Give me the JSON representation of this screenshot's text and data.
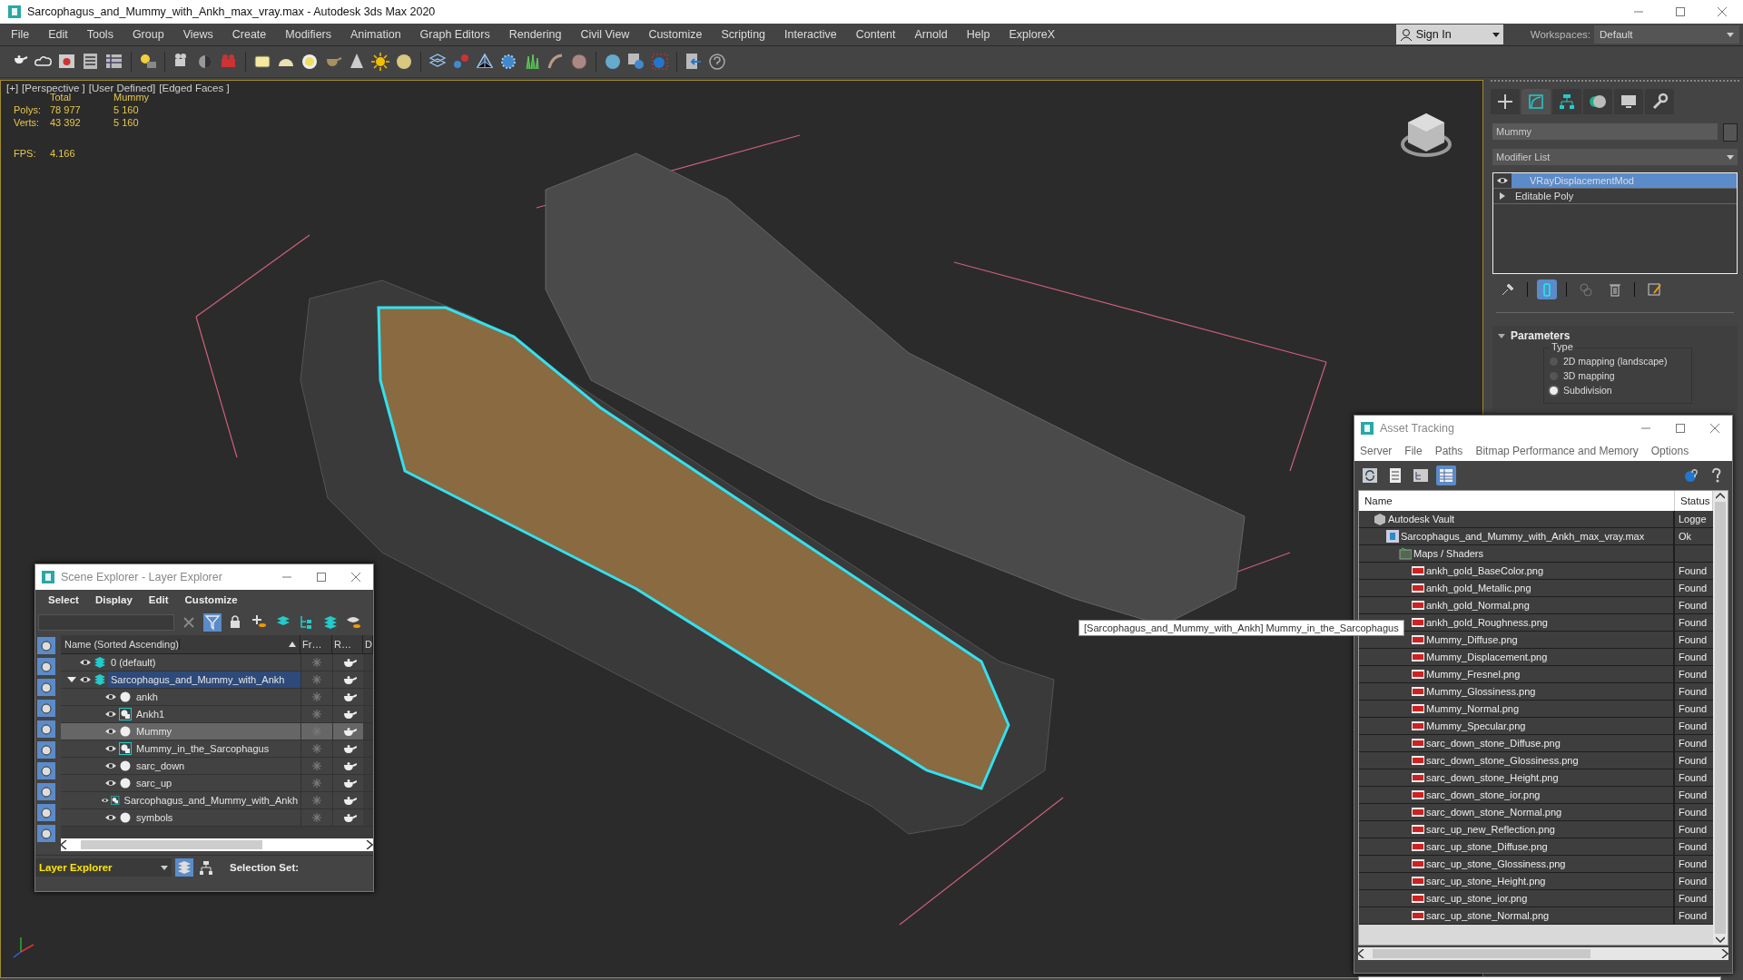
{
  "window": {
    "title": "Sarcophagus_and_Mummy_with_Ankh_max_vray.max - Autodesk 3ds Max 2020"
  },
  "menu": [
    "File",
    "Edit",
    "Tools",
    "Group",
    "Views",
    "Create",
    "Modifiers",
    "Animation",
    "Graph Editors",
    "Rendering",
    "Civil View",
    "Customize",
    "Scripting",
    "Interactive",
    "Content",
    "Arnold",
    "Help",
    "ExploreX"
  ],
  "sign_in": {
    "label": "Sign In"
  },
  "workspaces": {
    "label": "Workspaces:",
    "value": "Default"
  },
  "viewport": {
    "labels": [
      "[+]",
      "[Perspective ]",
      "[User Defined]",
      "[Edged Faces ]"
    ],
    "stats": {
      "headers": [
        "Total",
        "Mummy"
      ],
      "rows": [
        {
          "label": "Polys:",
          "values": [
            "78 977",
            "5 160"
          ]
        },
        {
          "label": "Verts:",
          "values": [
            "43 392",
            "5 160"
          ]
        }
      ],
      "fps": {
        "label": "FPS:",
        "value": "4.166"
      }
    },
    "tooltip": "[Sarcophagus_and_Mummy_with_Ankh] Mummy_in_the_Sarcophagus"
  },
  "command_panel": {
    "tabs": [
      {
        "selected": false
      },
      {
        "selected": true
      },
      {
        "selected": false
      },
      {
        "selected": false
      },
      {
        "selected": false
      },
      {
        "selected": false
      }
    ],
    "object_name": "Mummy",
    "modifier_list": "Modifier List",
    "stack": [
      {
        "label": "VRayDisplacementMod",
        "kind": "modifier",
        "selected": true
      },
      {
        "label": "Editable Poly",
        "kind": "base",
        "selected": false
      }
    ],
    "show_end_result": true,
    "parameters": {
      "title": "Parameters",
      "group": "Type",
      "options": [
        {
          "label": "2D mapping (landscape)",
          "selected": false
        },
        {
          "label": "3D mapping",
          "selected": false
        },
        {
          "label": "Subdivision",
          "selected": true
        }
      ]
    }
  },
  "scene_explorer": {
    "title": "Scene Explorer - Layer Explorer",
    "menu": [
      "Select",
      "Display",
      "Edit",
      "Customize"
    ],
    "filter_on": true,
    "display_filters": [
      {
        "on": true
      },
      {
        "on": true
      },
      {
        "on": true
      },
      {
        "on": true
      },
      {
        "on": true
      },
      {
        "on": true
      },
      {
        "on": true
      },
      {
        "on": true
      },
      {
        "on": true
      },
      {
        "on": true
      }
    ],
    "columns": [
      "Name (Sorted Ascending)",
      "Fr…",
      "R…",
      "D"
    ],
    "tree": [
      {
        "name": "0 (default)",
        "kind": "layer",
        "selected": false
      },
      {
        "name": "Sarcophagus_and_Mummy_with_Ankh",
        "kind": "layer",
        "selected": true,
        "expanded": true,
        "children": [
          {
            "name": "ankh",
            "kind": "object",
            "selected": false
          },
          {
            "name": "Ankh1",
            "kind": "group",
            "selected": false
          },
          {
            "name": "Mummy",
            "kind": "object",
            "selected": true
          },
          {
            "name": "Mummy_in_the_Sarcophagus",
            "kind": "group",
            "selected": false
          },
          {
            "name": "sarc_down",
            "kind": "object",
            "selected": false
          },
          {
            "name": "sarc_up",
            "kind": "object",
            "selected": false
          },
          {
            "name": "Sarcophagus_and_Mummy_with_Ankh",
            "kind": "group",
            "selected": false
          },
          {
            "name": "symbols",
            "kind": "object",
            "selected": false
          }
        ]
      }
    ],
    "footer": {
      "explorer": "Layer Explorer",
      "selection_set": "Selection Set:"
    }
  },
  "asset_tracking": {
    "title": "Asset Tracking",
    "menu": [
      "Server",
      "File",
      "Paths",
      "Bitmap Performance and Memory",
      "Options"
    ],
    "view_buttons": [
      {
        "selected": false
      },
      {
        "selected": false
      },
      {
        "selected": false
      },
      {
        "selected": true
      }
    ],
    "columns": [
      "Name",
      "Status"
    ],
    "tree": [
      {
        "name": "Autodesk Vault",
        "kind": "vault",
        "status": "Logge",
        "children": [
          {
            "name": "Sarcophagus_and_Mummy_with_Ankh_max_vray.max",
            "kind": "scene",
            "status": "Ok",
            "children": [
              {
                "name": "Maps / Shaders",
                "kind": "folder",
                "children": [
                  {
                    "name": "ankh_gold_BaseColor.png",
                    "kind": "png",
                    "status": "Found"
                  },
                  {
                    "name": "ankh_gold_Metallic.png",
                    "kind": "png",
                    "status": "Found"
                  },
                  {
                    "name": "ankh_gold_Normal.png",
                    "kind": "png",
                    "status": "Found"
                  },
                  {
                    "name": "ankh_gold_Roughness.png",
                    "kind": "png",
                    "status": "Found"
                  },
                  {
                    "name": "Mummy_Diffuse.png",
                    "kind": "png",
                    "status": "Found"
                  },
                  {
                    "name": "Mummy_Displacement.png",
                    "kind": "png",
                    "status": "Found"
                  },
                  {
                    "name": "Mummy_Fresnel.png",
                    "kind": "png",
                    "status": "Found"
                  },
                  {
                    "name": "Mummy_Glossiness.png",
                    "kind": "png",
                    "status": "Found"
                  },
                  {
                    "name": "Mummy_Normal.png",
                    "kind": "png",
                    "status": "Found"
                  },
                  {
                    "name": "Mummy_Specular.png",
                    "kind": "png",
                    "status": "Found"
                  },
                  {
                    "name": "sarc_down_stone_Diffuse.png",
                    "kind": "png",
                    "status": "Found"
                  },
                  {
                    "name": "sarc_down_stone_Glossiness.png",
                    "kind": "png",
                    "status": "Found"
                  },
                  {
                    "name": "sarc_down_stone_Height.png",
                    "kind": "png",
                    "status": "Found"
                  },
                  {
                    "name": "sarc_down_stone_ior.png",
                    "kind": "png",
                    "status": "Found"
                  },
                  {
                    "name": "sarc_down_stone_Normal.png",
                    "kind": "png",
                    "status": "Found"
                  },
                  {
                    "name": "sarc_up_new_Reflection.png",
                    "kind": "png",
                    "status": "Found"
                  },
                  {
                    "name": "sarc_up_stone_Diffuse.png",
                    "kind": "png",
                    "status": "Found"
                  },
                  {
                    "name": "sarc_up_stone_Glossiness.png",
                    "kind": "png",
                    "status": "Found"
                  },
                  {
                    "name": "sarc_up_stone_Height.png",
                    "kind": "png",
                    "status": "Found"
                  },
                  {
                    "name": "sarc_up_stone_ior.png",
                    "kind": "png",
                    "status": "Found"
                  },
                  {
                    "name": "sarc_up_stone_Normal.png",
                    "kind": "png",
                    "status": "Found"
                  }
                ]
              }
            ]
          }
        ]
      }
    ]
  }
}
